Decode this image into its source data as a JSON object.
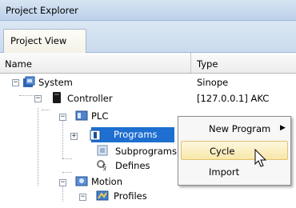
{
  "window": {
    "title": "Project Explorer"
  },
  "tabs": [
    {
      "label": "Project View"
    }
  ],
  "columns": {
    "name": "Name",
    "type": "Type"
  },
  "tree": [
    {
      "label": "System",
      "type": "Sinope"
    },
    {
      "label": "Controller",
      "type": "[127.0.0.1] AKC"
    },
    {
      "label": "PLC",
      "type": ""
    },
    {
      "label": "Programs",
      "type": "",
      "selected": true
    },
    {
      "label": "Subprograms",
      "type": ""
    },
    {
      "label": "Defines",
      "type": ""
    },
    {
      "label": "Motion",
      "type": ""
    },
    {
      "label": "Profiles",
      "type": ""
    }
  ],
  "context_menu": {
    "items": [
      {
        "label": "New Program",
        "submenu_arrow": "▶"
      },
      {
        "label": "Cycle",
        "highlighted": true
      },
      {
        "label": "Import"
      }
    ]
  },
  "colors": {
    "selection": "#1e6fd0",
    "menu_highlight": "#f8e7a9"
  }
}
